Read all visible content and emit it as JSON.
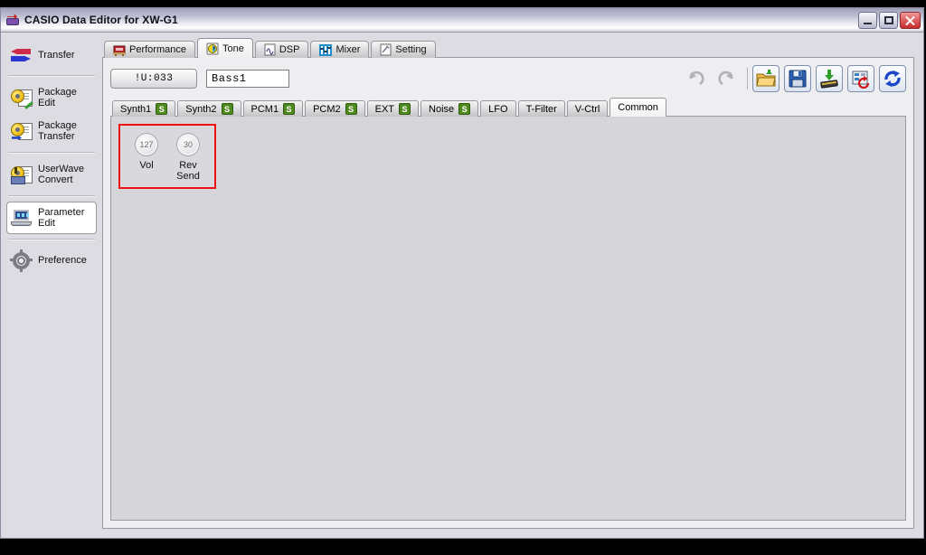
{
  "window": {
    "title": "CASIO Data Editor for XW-G1",
    "app_icon": "casio-transfer-icon",
    "buttons": {
      "minimize": "minimize-button",
      "maximize": "maximize-button",
      "close": "close-button"
    }
  },
  "sidebar": {
    "items": [
      {
        "label": "Transfer",
        "icon": "transfer-arrows-icon",
        "selected": false
      },
      {
        "label": "Package\nEdit",
        "icon": "package-edit-icon",
        "selected": false
      },
      {
        "label": "Package\nTransfer",
        "icon": "package-transfer-icon",
        "selected": false
      },
      {
        "label": "UserWave\nConvert",
        "icon": "userwave-convert-icon",
        "selected": false
      },
      {
        "label": "Parameter\nEdit",
        "icon": "parameter-edit-icon",
        "selected": true
      },
      {
        "label": "Preference",
        "icon": "gear-icon",
        "selected": false
      }
    ]
  },
  "main_tabs": [
    {
      "label": "Performance",
      "icon": "performance-icon",
      "active": false
    },
    {
      "label": "Tone",
      "icon": "tone-icon",
      "active": true
    },
    {
      "label": "DSP",
      "icon": "dsp-icon",
      "active": false
    },
    {
      "label": "Mixer",
      "icon": "mixer-icon",
      "active": false
    },
    {
      "label": "Setting",
      "icon": "setting-icon",
      "active": false
    }
  ],
  "toolbar": {
    "preset_number": "!U:033",
    "tone_name": "Bass1",
    "tone_name_placeholder": "Tone Name",
    "buttons": [
      {
        "name": "undo-button",
        "icon": "undo-icon",
        "enabled": false
      },
      {
        "name": "redo-button",
        "icon": "redo-icon",
        "enabled": false
      },
      {
        "name": "open-button",
        "icon": "open-folder-icon",
        "enabled": true
      },
      {
        "name": "save-button",
        "icon": "floppy-save-icon",
        "enabled": true
      },
      {
        "name": "write-button",
        "icon": "download-chip-icon",
        "enabled": true
      },
      {
        "name": "initialize-button",
        "icon": "initialize-icon",
        "enabled": true
      },
      {
        "name": "sync-button",
        "icon": "sync-refresh-icon",
        "enabled": true
      }
    ]
  },
  "sub_tabs": [
    {
      "label": "Synth1",
      "badge": "S",
      "active": false
    },
    {
      "label": "Synth2",
      "badge": "S",
      "active": false
    },
    {
      "label": "PCM1",
      "badge": "S",
      "active": false
    },
    {
      "label": "PCM2",
      "badge": "S",
      "active": false
    },
    {
      "label": "EXT",
      "badge": "S",
      "active": false
    },
    {
      "label": "Noise",
      "badge": "S",
      "active": false
    },
    {
      "label": "LFO",
      "badge": "",
      "active": false
    },
    {
      "label": "T-Filter",
      "badge": "",
      "active": false
    },
    {
      "label": "V-Ctrl",
      "badge": "",
      "active": false
    },
    {
      "label": "Common",
      "badge": "",
      "active": true
    }
  ],
  "common_panel": {
    "highlight_color": "#ee1111",
    "knobs": [
      {
        "label": "Vol",
        "value": "127"
      },
      {
        "label": "Rev\nSend",
        "value": "30"
      }
    ]
  }
}
